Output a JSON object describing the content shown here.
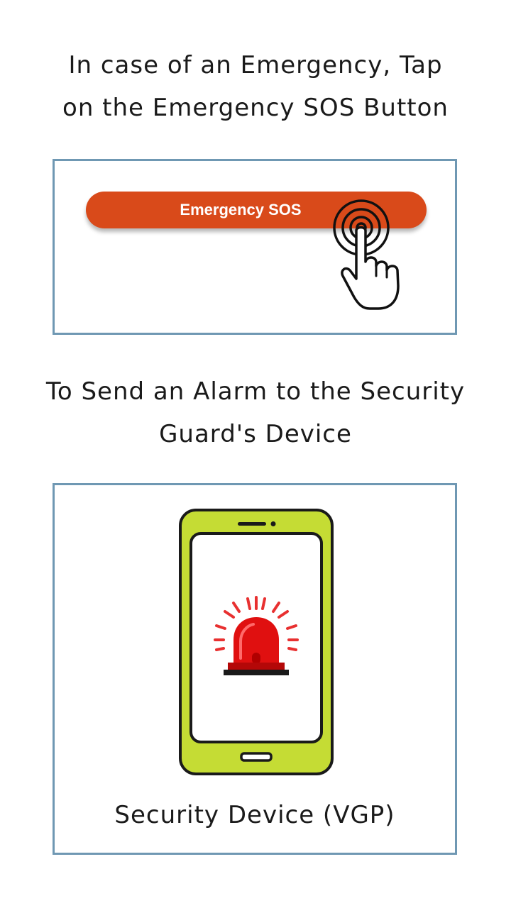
{
  "step1": {
    "heading_line1": "In case of an Emergency, Tap",
    "heading_line2": "on the Emergency SOS Button"
  },
  "sos_button": {
    "label": "Emergency SOS",
    "color": "#d94a1a"
  },
  "step2": {
    "heading_line1": "To Send an Alarm to the Security",
    "heading_line2": "Guard's Device"
  },
  "device": {
    "caption": "Security Device (VGP)",
    "phone_color": "#c5dc34",
    "alarm_color": "#e01010"
  },
  "frame_color": "#6f98b3",
  "icons": [
    "tap-hand-icon",
    "phone-icon",
    "siren-alarm-icon"
  ]
}
